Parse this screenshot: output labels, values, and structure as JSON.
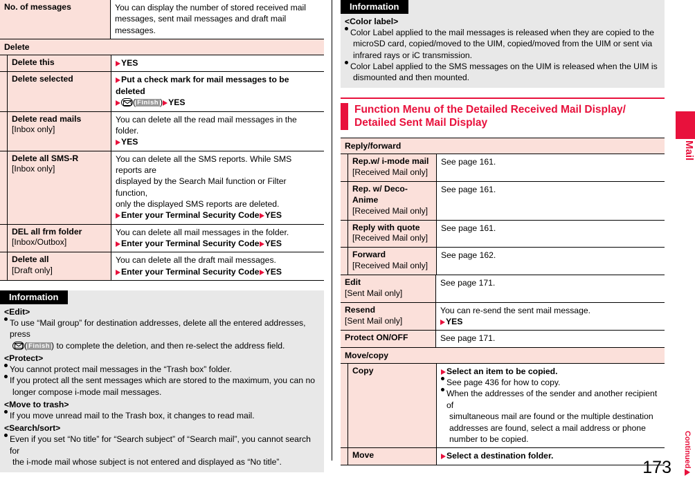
{
  "page": {
    "number": "173",
    "continued_label": "Continued",
    "side_tab_label": "Mail"
  },
  "left_column": {
    "table": {
      "rows": [
        {
          "kind": "toplabel",
          "label": "No. of messages",
          "desc_lines": [
            "You can display the number of stored received mail",
            "messages, sent mail messages and draft mail messages."
          ]
        },
        {
          "kind": "category",
          "label": "Delete"
        },
        {
          "kind": "sub",
          "label": "Delete this",
          "sublabel": "",
          "desc_lines": [],
          "steps": [
            "YES"
          ]
        },
        {
          "kind": "sub",
          "label": "Delete selected",
          "sublabel": "",
          "desc_lines": [],
          "steps_special": "delete-selected"
        },
        {
          "kind": "sub",
          "label": "Delete read mails",
          "sublabel": "[Inbox only]",
          "desc_lines": [
            "You can delete all the read mail messages in the folder."
          ],
          "steps": [
            "YES"
          ]
        },
        {
          "kind": "sub",
          "label": "Delete all SMS-R",
          "sublabel": "[Inbox only]",
          "desc_lines": [
            "You can delete all the SMS reports. While SMS reports are",
            "displayed by the Search Mail function or Filter function,",
            "only the displayed SMS reports are deleted."
          ],
          "steps": [
            "Enter your Terminal Security Code",
            "YES"
          ]
        },
        {
          "kind": "sub",
          "label": "DEL all frm folder",
          "sublabel": "[Inbox/Outbox]",
          "desc_lines": [
            "You can delete all mail messages in the folder."
          ],
          "steps": [
            "Enter your Terminal Security Code",
            "YES"
          ]
        },
        {
          "kind": "sub",
          "label": "Delete all",
          "sublabel": "[Draft only]",
          "desc_lines": [
            "You can delete all the draft mail messages."
          ],
          "steps": [
            "Enter your Terminal Security Code",
            "YES"
          ]
        }
      ]
    },
    "information": {
      "header": "Information",
      "blocks": [
        {
          "tag": "<Edit>",
          "items": [
            {
              "type": "finish",
              "lines": [
                "To use “Mail group” for destination addresses, delete all the entered addresses, press",
                ") to complete the deletion, and then re-select the address field."
              ],
              "finish_label": "Finish"
            }
          ]
        },
        {
          "tag": "<Protect>",
          "items": [
            {
              "type": "plain",
              "lines": [
                "You cannot protect mail messages in the “Trash box” folder."
              ]
            },
            {
              "type": "plain",
              "lines": [
                "If you protect all the sent messages which are stored to the maximum, you can no",
                "longer compose i-mode mail messages."
              ]
            }
          ]
        },
        {
          "tag": "<Move to trash>",
          "items": [
            {
              "type": "plain",
              "lines": [
                "If you move unread mail to the Trash box, it changes to read mail."
              ]
            }
          ]
        },
        {
          "tag": "<Search/sort>",
          "items": [
            {
              "type": "plain",
              "lines": [
                "Even if you set “No title” for “Search subject” of “Search mail”, you cannot search for",
                "the i-mode mail whose subject is not entered and displayed as “No title”."
              ]
            }
          ]
        }
      ]
    }
  },
  "right_column": {
    "information": {
      "header": "Information",
      "blocks": [
        {
          "tag": "<Color label>",
          "items": [
            {
              "type": "plain",
              "lines": [
                "Color Label applied to the mail messages is released when they are copied to the",
                "microSD card, copied/moved to the UIM, copied/moved from the UIM or sent via",
                "infrared rays or iC transmission."
              ]
            },
            {
              "type": "plain",
              "lines": [
                "Color Label applied to the SMS messages on the UIM is released when the UIM is",
                "dismounted and then mounted."
              ]
            }
          ]
        }
      ]
    },
    "section": {
      "title_line1": "Function Menu of the Detailed Received Mail Display/",
      "title_line2": "Detailed Sent Mail Display"
    },
    "table": {
      "rows": [
        {
          "kind": "category",
          "label": "Reply/forward"
        },
        {
          "kind": "sub",
          "label": "Rep.w/ i-mode mail",
          "sublabel": "[Received Mail only]",
          "desc_lines": [
            "See page 161."
          ]
        },
        {
          "kind": "sub",
          "label": "Rep. w/ Deco-Anime",
          "sublabel": "[Received Mail only]",
          "desc_lines": [
            "See page 161."
          ]
        },
        {
          "kind": "sub",
          "label": "Reply with quote",
          "sublabel": "[Received Mail only]",
          "desc_lines": [
            "See page 161."
          ]
        },
        {
          "kind": "sub",
          "label": "Forward",
          "sublabel": "[Received Mail only]",
          "desc_lines": [
            "See page 162."
          ]
        },
        {
          "kind": "toplabel",
          "label": "Edit",
          "sublabel": "[Sent Mail only]",
          "desc_lines": [
            "See page 171."
          ]
        },
        {
          "kind": "toplabel",
          "label": "Resend",
          "sublabel": "[Sent Mail only]",
          "desc_lines": [
            "You can re-send the sent mail message."
          ],
          "steps": [
            "YES"
          ]
        },
        {
          "kind": "toplabel",
          "label": "Protect ON/OFF",
          "sublabel": "",
          "desc_lines": [
            "See page 171."
          ]
        },
        {
          "kind": "category",
          "label": "Move/copy"
        },
        {
          "kind": "sub",
          "label": "Copy",
          "sublabel": "",
          "step_first": "Select an item to be copied.",
          "bullets": [
            [
              "See page 436 for how to copy."
            ],
            [
              "When the addresses of the sender and another recipient of",
              "simultaneous mail are found or the multiple destination",
              "addresses are found, select a mail address or phone",
              "number to be copied."
            ]
          ]
        },
        {
          "kind": "sub",
          "label": "Move",
          "sublabel": "",
          "step_first": "Select a destination folder."
        }
      ]
    }
  },
  "colors": {
    "accent_red": "#e8113c",
    "table_label_bg": "#fbe0da",
    "info_bg": "#e8e8e8"
  }
}
